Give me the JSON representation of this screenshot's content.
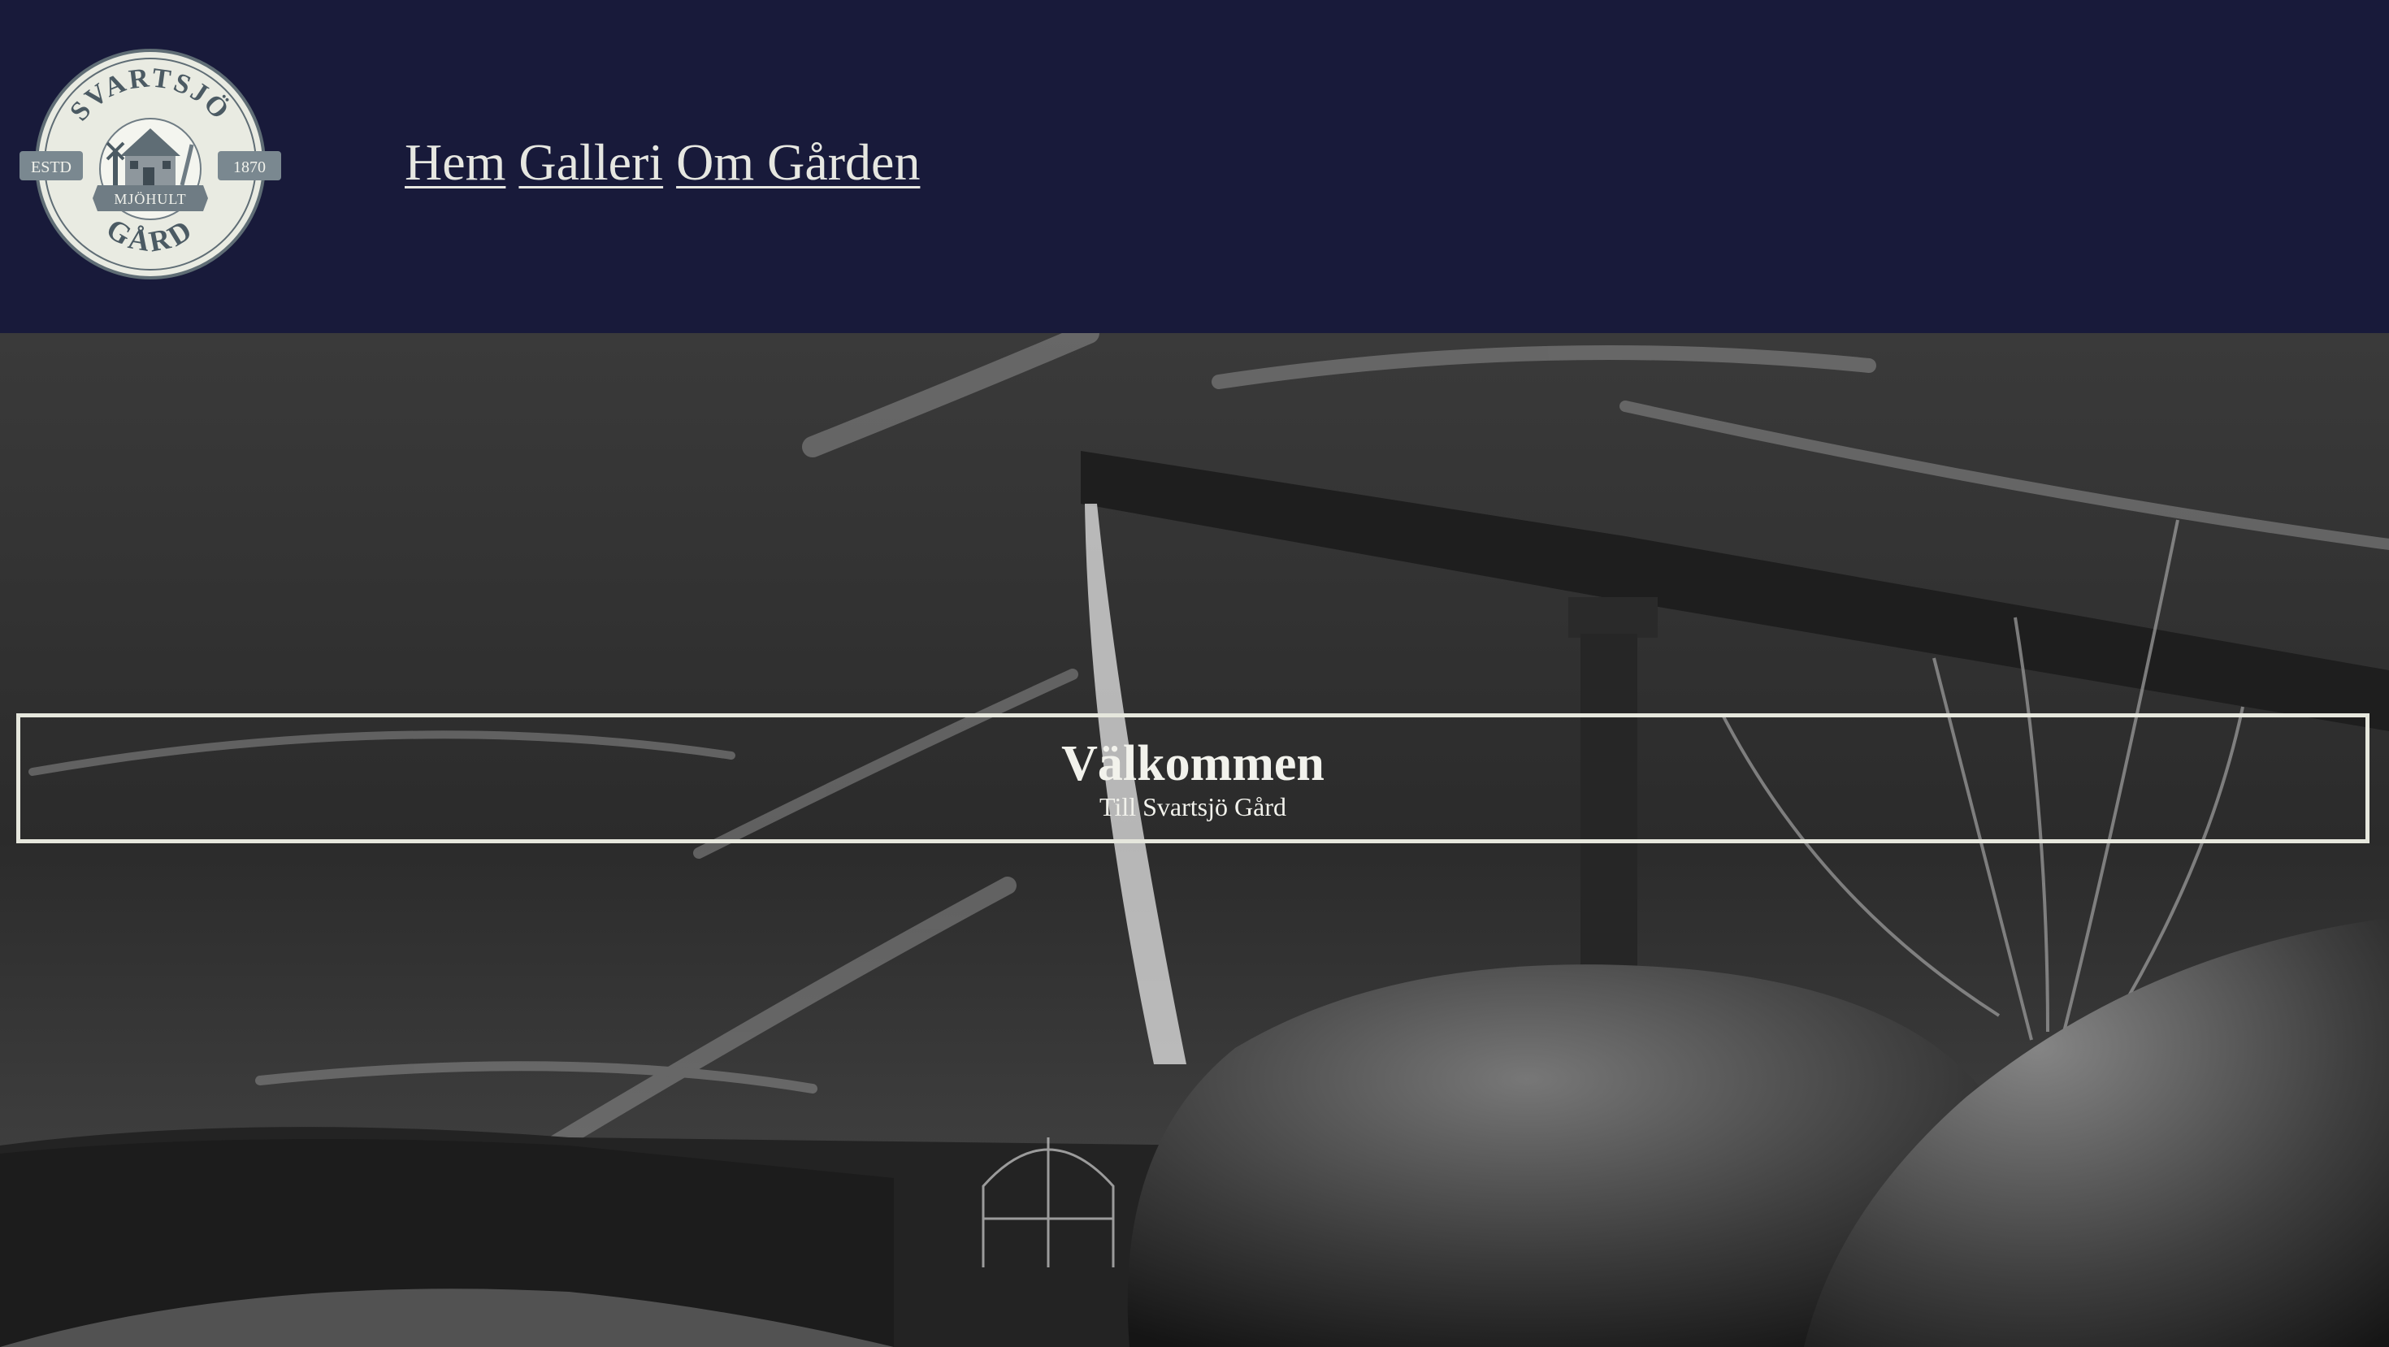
{
  "logo": {
    "top_text": "SVARTSJÖ",
    "bottom_text": "GÅRD",
    "left_badge": "ESTD",
    "right_badge": "1870",
    "ribbon": "MJÖHULT"
  },
  "nav": {
    "items": [
      {
        "label": "Hem"
      },
      {
        "label": "Galleri"
      },
      {
        "label": "Om Gården"
      }
    ]
  },
  "hero": {
    "title": "Välkommen",
    "subtitle": "Till Svartsjö Gård"
  },
  "colors": {
    "header_bg": "#181a3a",
    "nav_text": "#e6e7e1",
    "hero_text": "#f2f2ec"
  }
}
